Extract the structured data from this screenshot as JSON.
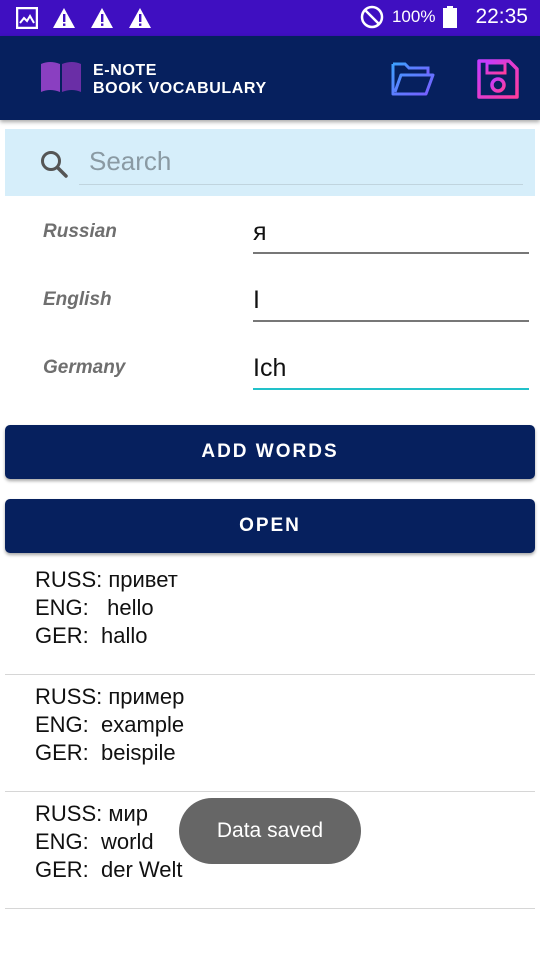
{
  "status_bar": {
    "left_icons": [
      "image-icon",
      "warning-icon",
      "warning-icon",
      "warning-icon"
    ],
    "dnd_icon": "do-not-disturb-icon",
    "battery_text": "100%",
    "time": "22:35"
  },
  "app_bar": {
    "logo_icon": "book-icon",
    "title_line1": "E-NOTE",
    "title_line2": "BOOK VOCABULARY",
    "actions": [
      {
        "name": "open-folder-button",
        "icon": "folder-open-icon"
      },
      {
        "name": "save-button",
        "icon": "floppy-disk-icon"
      }
    ]
  },
  "search": {
    "placeholder": "Search",
    "value": ""
  },
  "form": {
    "russian_label": "Russian",
    "russian_value": "я",
    "english_label": "English",
    "english_value": "I",
    "german_label": "Germany",
    "german_value": "Ich"
  },
  "buttons": {
    "add_words": "ADD WORDS",
    "open": "OPEN"
  },
  "words": [
    {
      "russ": "RUSS: привет",
      "eng": "ENG:   hello",
      "ger": "GER:  hallo"
    },
    {
      "russ": "RUSS: пример",
      "eng": "ENG:  example",
      "ger": "GER:  beispile"
    },
    {
      "russ": "RUSS: мир",
      "eng": "ENG:  world",
      "ger": "GER:  der Welt"
    }
  ],
  "toast": "Data saved",
  "colors": {
    "status_bar": "#3f0fc1",
    "app_bar": "#06205e",
    "search_bg": "#d6eefa",
    "active_underline": "#22c1c9",
    "toast_bg": "#666666"
  }
}
